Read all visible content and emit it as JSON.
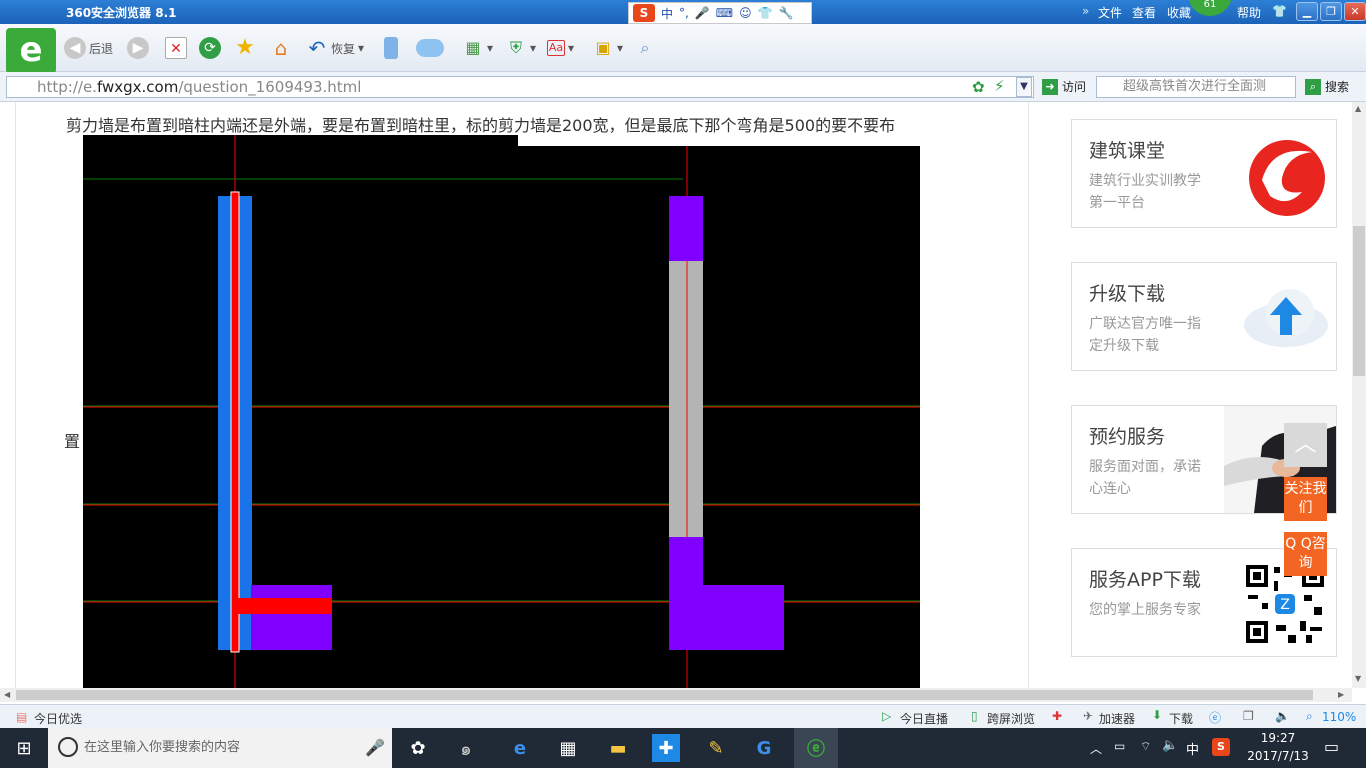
{
  "window": {
    "title": "360安全浏览器 8.1",
    "menu": [
      "文件",
      "查看",
      "收藏",
      "帮助"
    ],
    "badge": "61",
    "ime": {
      "logo": "S",
      "items": [
        "中",
        "°,"
      ]
    }
  },
  "toolbar": {
    "back_label": "后退",
    "restore_label": "恢复"
  },
  "address": {
    "url_prefix": "http://e.",
    "url_domain": "fwxgx.com",
    "url_path": "/question_1609493.html",
    "visit_label": "访问",
    "search_placeholder": "超级高铁首次进行全面测",
    "search_label": "搜索"
  },
  "content": {
    "question_text": "剪力墙是布置到暗柱内端还是外端，要是布置到暗柱里，标的剪力墙是200宽，但是最底下那个弯角是500的要不要布",
    "question_tail": "置"
  },
  "sidebar": {
    "cards": [
      {
        "title": "建筑课堂",
        "desc": "建筑行业实训教学第一平台",
        "icon": "red-swirl-logo"
      },
      {
        "title": "升级下载",
        "desc": "广联达官方唯一指定升级下载",
        "icon": "cloud-upload-icon"
      },
      {
        "title": "预约服务",
        "desc": "服务面对面，承诺心连心",
        "icon": "handshake-photo"
      },
      {
        "title": "服务APP下载",
        "desc": "您的掌上服务专家",
        "icon": "qr-code"
      }
    ],
    "float_follow": "关注我们",
    "float_qq": "Q Q咨询"
  },
  "statusbar": {
    "left": "今日优选",
    "live": "今日直播",
    "cross": "跨屏浏览",
    "accel": "加速器",
    "download": "下载",
    "zoom": "110%"
  },
  "taskbar": {
    "search_placeholder": "在这里输入你要搜索的内容",
    "ime": "中",
    "time": "19:27",
    "date": "2017/7/13"
  },
  "colors": {
    "blue_wall": "#1874e8",
    "red_line": "#ff0000",
    "purple_column": "#8000ff",
    "gray_wall": "#b4b4b4",
    "green_axis": "#008000",
    "orange_float": "#f26522"
  }
}
